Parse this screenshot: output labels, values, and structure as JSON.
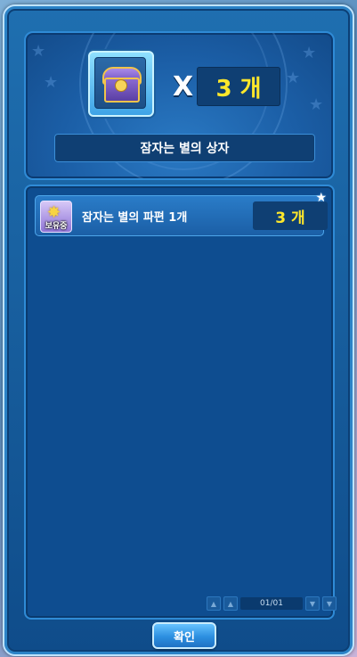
{
  "reward_box": {
    "multiplier_symbol": "X",
    "count": "3 개",
    "name": "잠자는 별의 상자",
    "icon": "treasure-chest-icon"
  },
  "list": {
    "items": [
      {
        "icon": "star-icon",
        "icon_tag": "보유중",
        "name": "잠자는 별의 파편 1개",
        "count": "3 개"
      }
    ]
  },
  "pager": {
    "text": "01/01",
    "first": "▲",
    "prev": "▲",
    "next": "▼",
    "last": "▼"
  },
  "buttons": {
    "confirm": "확인"
  },
  "colors": {
    "accent_yellow": "#ffe82b",
    "panel_blue": "#0e4d90"
  }
}
